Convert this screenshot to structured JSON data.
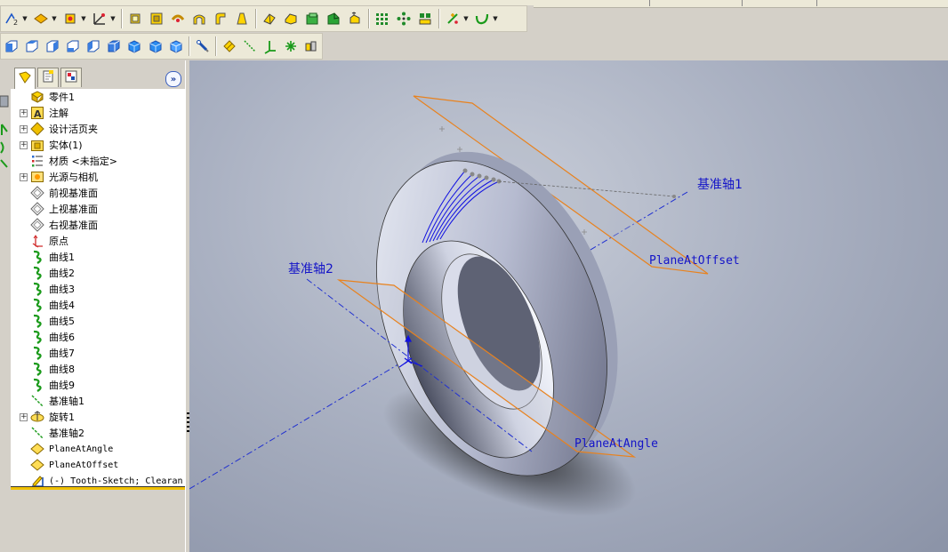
{
  "toolbar_sketch": {
    "buttons": [
      "smart-dimension-icon",
      "sketch-entities-icon",
      "display-relations-icon",
      "sketch-tools-icon",
      "extrude-boss-icon",
      "revolve-boss-icon",
      "sweep-icon",
      "loft-icon",
      "fillet-icon",
      "chamfer-icon",
      "rib-icon",
      "shell-icon",
      "draft-icon",
      "hole-wizard-icon",
      "linear-pattern-icon",
      "circular-pattern-icon",
      "mirror-icon",
      "reference-geometry-icon",
      "curves-icon"
    ]
  },
  "toolbar_views": {
    "buttons": [
      "front-view-icon",
      "back-view-icon",
      "left-view-icon",
      "right-view-icon",
      "top-view-icon",
      "isometric-view-icon",
      "trimetric-view-icon",
      "dimetric-view-icon",
      "normal-to-icon",
      "plane-icon",
      "axis-icon",
      "coordinate-system-icon",
      "point-icon",
      "mate-reference-icon"
    ]
  },
  "panel_tabs": [
    "feature-manager-icon",
    "property-manager-icon",
    "configuration-manager-icon"
  ],
  "tree": {
    "items": [
      {
        "label": "零件1",
        "icon": "part-icon",
        "expander": "",
        "mono": false
      },
      {
        "label": "注解",
        "icon": "annotations-icon",
        "expander": "+",
        "mono": false
      },
      {
        "label": "设计活页夹",
        "icon": "design-binder-icon",
        "expander": "+",
        "mono": false
      },
      {
        "label": "实体(1)",
        "icon": "solid-bodies-icon",
        "expander": "+",
        "mono": false
      },
      {
        "label": "材质 <未指定>",
        "icon": "material-icon",
        "expander": "",
        "mono": false
      },
      {
        "label": "光源与相机",
        "icon": "lights-cameras-icon",
        "expander": "+",
        "mono": false
      },
      {
        "label": "前视基准面",
        "icon": "plane-icon",
        "expander": "",
        "mono": false
      },
      {
        "label": "上视基准面",
        "icon": "plane-icon",
        "expander": "",
        "mono": false
      },
      {
        "label": "右视基准面",
        "icon": "plane-icon",
        "expander": "",
        "mono": false
      },
      {
        "label": "原点",
        "icon": "origin-icon",
        "expander": "",
        "mono": false
      },
      {
        "label": "曲线1",
        "icon": "curve-icon",
        "expander": "",
        "mono": false
      },
      {
        "label": "曲线2",
        "icon": "curve-icon",
        "expander": "",
        "mono": false
      },
      {
        "label": "曲线3",
        "icon": "curve-icon",
        "expander": "",
        "mono": false
      },
      {
        "label": "曲线4",
        "icon": "curve-icon",
        "expander": "",
        "mono": false
      },
      {
        "label": "曲线5",
        "icon": "curve-icon",
        "expander": "",
        "mono": false
      },
      {
        "label": "曲线6",
        "icon": "curve-icon",
        "expander": "",
        "mono": false
      },
      {
        "label": "曲线7",
        "icon": "curve-icon",
        "expander": "",
        "mono": false
      },
      {
        "label": "曲线8",
        "icon": "curve-icon",
        "expander": "",
        "mono": false
      },
      {
        "label": "曲线9",
        "icon": "curve-icon",
        "expander": "",
        "mono": false
      },
      {
        "label": "基准轴1",
        "icon": "axis-icon",
        "expander": "",
        "mono": false
      },
      {
        "label": "旋转1",
        "icon": "revolve-icon",
        "expander": "+",
        "mono": false
      },
      {
        "label": "基准轴2",
        "icon": "axis-icon",
        "expander": "",
        "mono": false
      },
      {
        "label": "PlaneAtAngle",
        "icon": "ref-plane-icon",
        "expander": "",
        "mono": true
      },
      {
        "label": "PlaneAtOffset",
        "icon": "ref-plane-icon",
        "expander": "",
        "mono": true
      },
      {
        "label": "(-) Tooth-Sketch; Clearan",
        "icon": "sketch-icon",
        "expander": "",
        "mono": true
      }
    ]
  },
  "viewport": {
    "labels": {
      "axis1": "基准轴1",
      "axis2": "基准轴2",
      "plane_offset": "PlaneAtOffset",
      "plane_angle": "PlaneAtAngle"
    }
  },
  "colors": {
    "label_blue": "#1414c8",
    "plane_orange": "#e8821e",
    "axis_blue": "#2030d0"
  }
}
